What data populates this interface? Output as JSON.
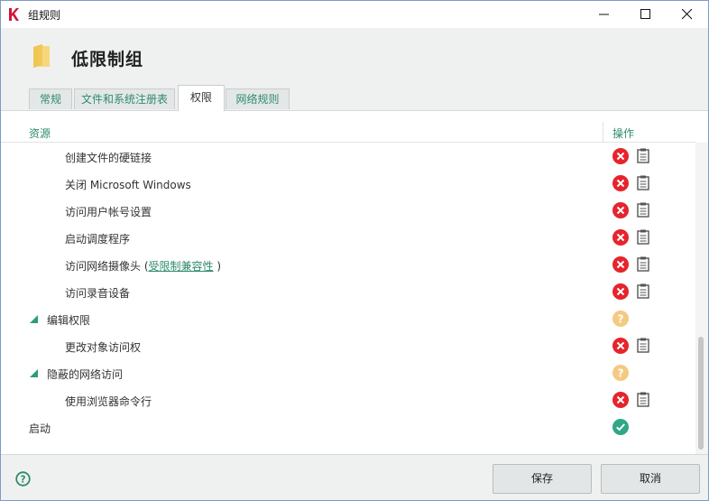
{
  "window": {
    "title": "组规则"
  },
  "header": {
    "group_title": "低限制组"
  },
  "tabs": [
    {
      "label": "常规",
      "active": false
    },
    {
      "label": "文件和系统注册表",
      "active": false
    },
    {
      "label": "权限",
      "active": true
    },
    {
      "label": "网络规则",
      "active": false
    }
  ],
  "table": {
    "col_resource": "资源",
    "col_action": "操作",
    "rows": [
      {
        "label": "创建文件的硬链接",
        "status": "deny"
      },
      {
        "label": "关闭 Microsoft Windows",
        "status": "deny"
      },
      {
        "label": "访问用户帐号设置",
        "status": "deny"
      },
      {
        "label": "启动调度程序",
        "status": "deny"
      },
      {
        "label": "访问网络摄像头 (",
        "link": "受限制兼容性",
        "suffix": ")",
        "status": "deny"
      },
      {
        "label": "访问录音设备",
        "status": "deny"
      },
      {
        "label": "编辑权限",
        "status": "question",
        "expandable": true
      },
      {
        "label": "更改对象访问权",
        "status": "deny"
      },
      {
        "label": "隐蔽的网络访问",
        "status": "question",
        "expandable": true
      },
      {
        "label": "使用浏览器命令行",
        "status": "deny"
      },
      {
        "label": "启动",
        "status": "allow"
      }
    ]
  },
  "footer": {
    "save_label": "保存",
    "cancel_label": "取消"
  },
  "colors": {
    "accent": "#2e8b6e",
    "deny": "#e5242c",
    "question": "#f4c981",
    "allow": "#2ea887"
  }
}
